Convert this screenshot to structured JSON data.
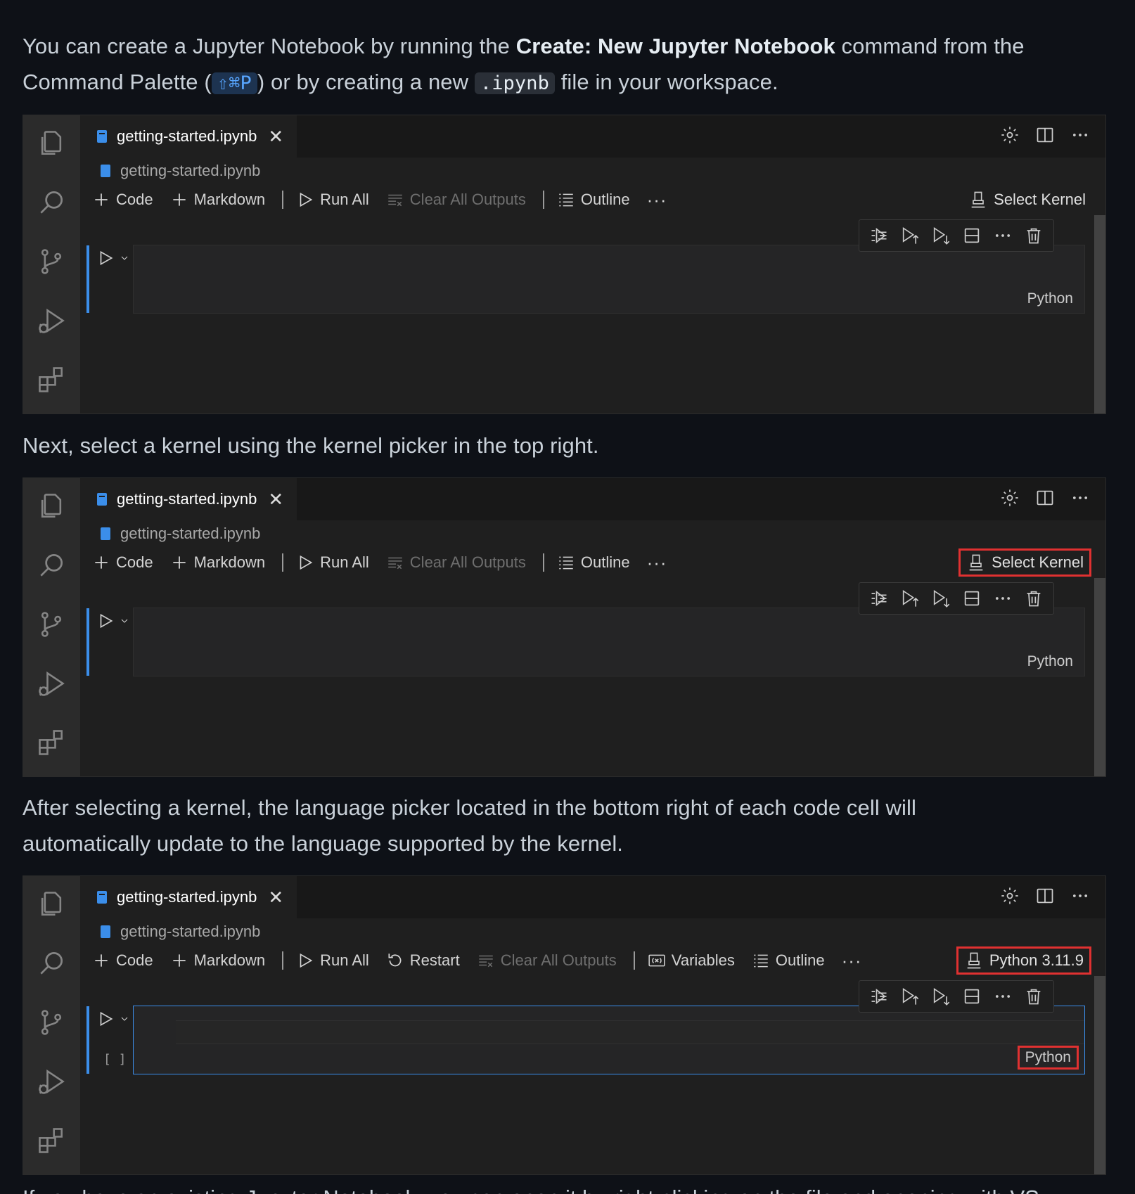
{
  "intro": {
    "text_before": "You can create a Jupyter Notebook by running the ",
    "command": "Create: New Jupyter Notebook",
    "text_middle": " command from the Command Palette (",
    "shortcut": "⇧⌘P",
    "text_after_shortcut": ") or by creating a new ",
    "file_ext": ".ipynb",
    "text_end": " file in your workspace."
  },
  "step2": {
    "text": "Next, select a kernel using the kernel picker in the top right."
  },
  "step3": {
    "text": "After selecting a kernel, the language picker located in the bottom right of each code cell will automatically update to the language supported by the kernel."
  },
  "footer_cutoff": {
    "text": "If you have an existing Jupyter Notebook, you can open it by right-clicking on the file and opening with VS"
  },
  "editor": {
    "tab_label": "getting-started.ipynb",
    "tab_close": "✕",
    "breadcrumb": "getting-started.ipynb",
    "toolbar": {
      "code": "Code",
      "markdown": "Markdown",
      "run_all": "Run All",
      "restart": "Restart",
      "clear_outputs": "Clear All Outputs",
      "variables": "Variables",
      "outline": "Outline",
      "more": "···"
    },
    "kernel_unselected": "Select Kernel",
    "kernel_selected": "Python 3.11.9",
    "cell_language": "Python",
    "cell_exec_count": "[ ]",
    "cell_more": "···"
  },
  "colors": {
    "highlight": "#e03131",
    "accent": "#3b8eea"
  }
}
